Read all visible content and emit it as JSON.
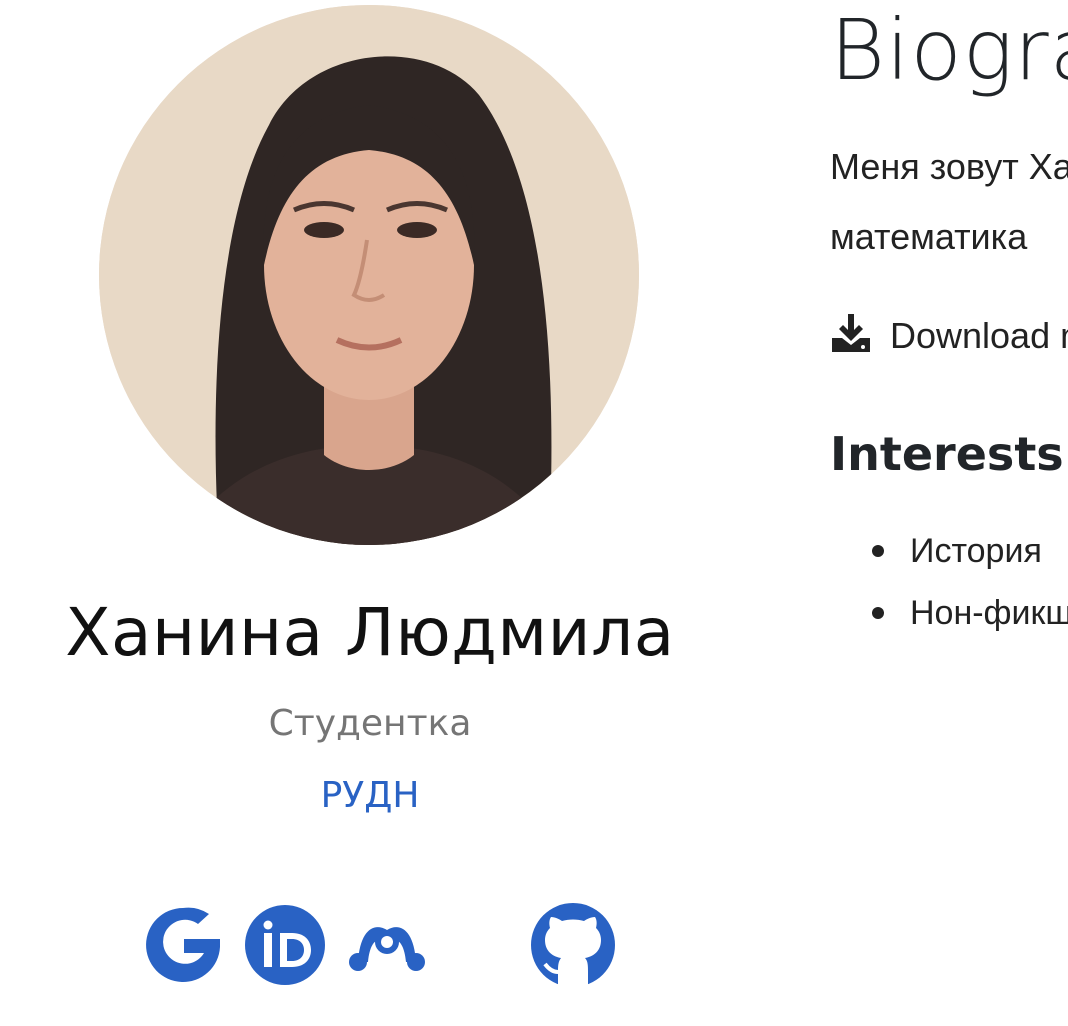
{
  "profile": {
    "name": "Ханина Людмила",
    "role": "Студентка",
    "organization": "РУДН",
    "social_links": [
      {
        "icon": "google-scholar-icon"
      },
      {
        "icon": "orcid-icon"
      },
      {
        "icon": "mendeley-icon"
      },
      {
        "icon": "github-icon"
      }
    ]
  },
  "biography": {
    "title": "Biography",
    "text": "Меня зовут Ханина Людмила. Изучаю фундаментальная информатика и прикладная",
    "text_line_2": "математика",
    "cv_link": "Download my resumé"
  },
  "interests": {
    "title": "Interests",
    "items": [
      "История",
      "Нон-фикшн"
    ]
  },
  "colors": {
    "accent": "#2962c4",
    "text": "#212529",
    "muted": "#757575"
  }
}
